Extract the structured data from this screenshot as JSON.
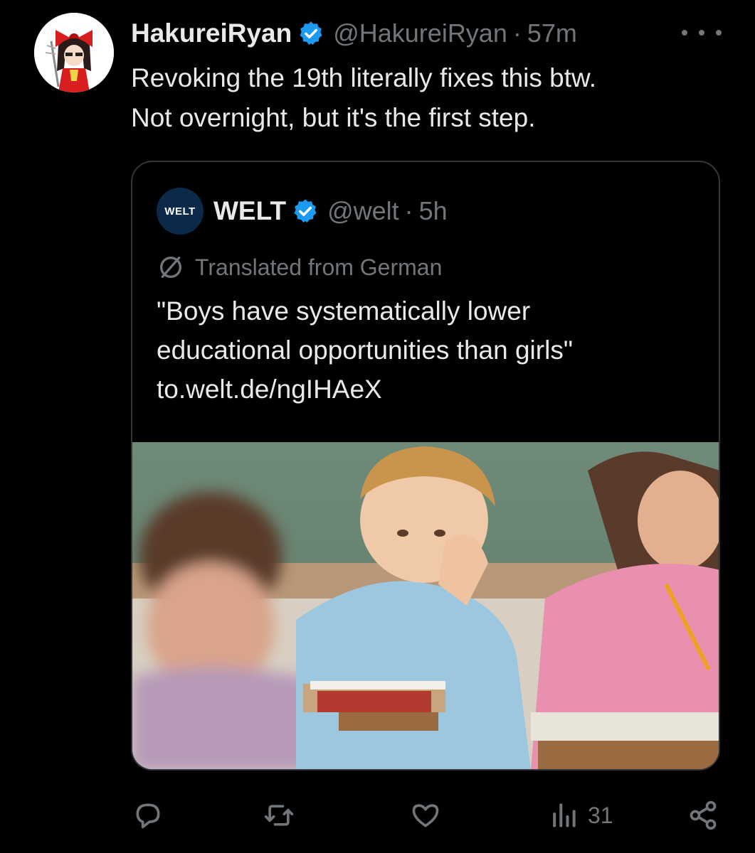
{
  "tweet": {
    "display_name": "HakureiRyan",
    "handle": "@HakureiRyan",
    "separator": "·",
    "time": "57m",
    "text_lines": [
      "Revoking the 19th literally fixes this btw.",
      "Not overnight, but it's the first step."
    ]
  },
  "quote": {
    "avatar_text": "WELT",
    "display_name": "WELT",
    "handle": "@welt",
    "separator": "·",
    "time": "5h",
    "translated_label": "Translated from German",
    "text_lines": [
      "\"Boys have systematically lower",
      "educational opportunities than girls\"",
      "to.welt.de/ngIHAeX"
    ]
  },
  "actions": {
    "views_count": "31"
  },
  "colors": {
    "background": "#000000",
    "text_primary": "#e7e9ea",
    "text_secondary": "#71767b",
    "verified_blue": "#1d9bf0",
    "border": "#333639"
  }
}
